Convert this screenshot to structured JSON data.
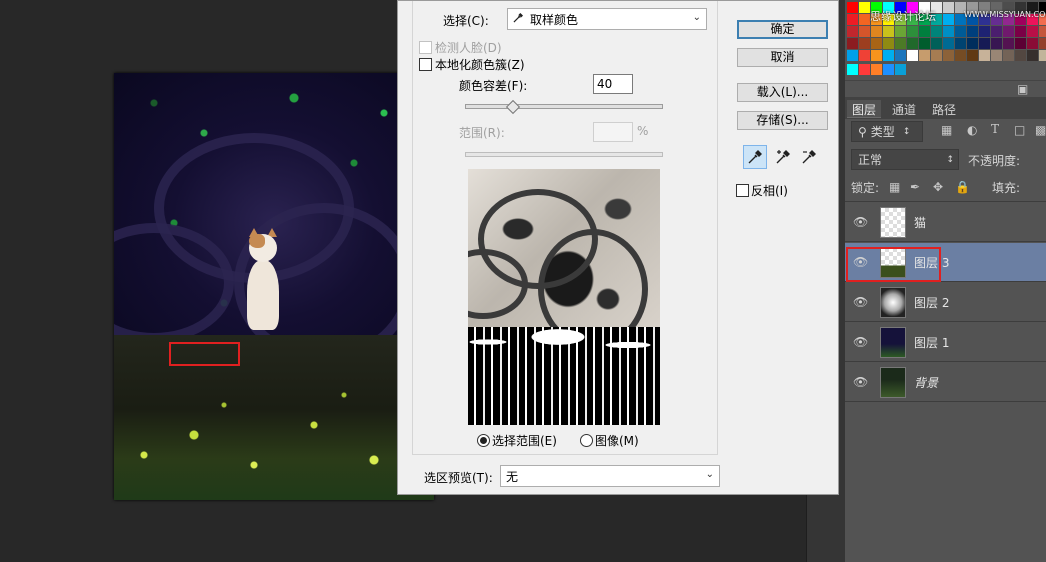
{
  "dialog": {
    "select_label": "选择(C):",
    "select_value": "取样颜色",
    "detect_faces_label": "检测人脸(D)",
    "localized_clusters_label": "本地化颜色簇(Z)",
    "fuzziness_label": "颜色容差(F):",
    "fuzziness_value": "40",
    "fuzziness_level": 0.24,
    "range_label": "范围(R):",
    "range_unit": "%",
    "radio_selection_label": "选择范围(E)",
    "radio_image_label": "图像(M)",
    "selection_preview_label": "选区预览(T):",
    "selection_preview_value": "无",
    "ok_label": "确定",
    "cancel_label": "取消",
    "load_label": "载入(L)...",
    "save_label": "存储(S)...",
    "invert_label": "反相(I)"
  },
  "watermark": {
    "left": "思缘设计论坛",
    "right": "WWW.MISSYUAN.COM"
  },
  "layers_panel": {
    "tabs": [
      "图层",
      "通道",
      "路径"
    ],
    "filter_label": "类型",
    "blend_mode": "正常",
    "opacity_label": "不透明度:",
    "lock_label": "锁定:",
    "fill_label": "填充:",
    "layers": [
      {
        "name": "猫",
        "selected": false
      },
      {
        "name": "图层 3",
        "selected": true
      },
      {
        "name": "图层 2",
        "selected": false
      },
      {
        "name": "图层 1",
        "selected": false
      },
      {
        "name": "背景",
        "selected": false
      }
    ]
  },
  "colors": {
    "accent_selected_layer": "#6b7fa3",
    "highlight_box": "#e02020",
    "default_button_border": "#3c7fb1"
  },
  "icons": {
    "select_eyedropper": "eyedropper-icon",
    "eyedropper_tools": [
      "eyedropper-icon",
      "eyedropper-plus-icon",
      "eyedropper-minus-icon"
    ],
    "layer_visibility": "eye-icon"
  }
}
